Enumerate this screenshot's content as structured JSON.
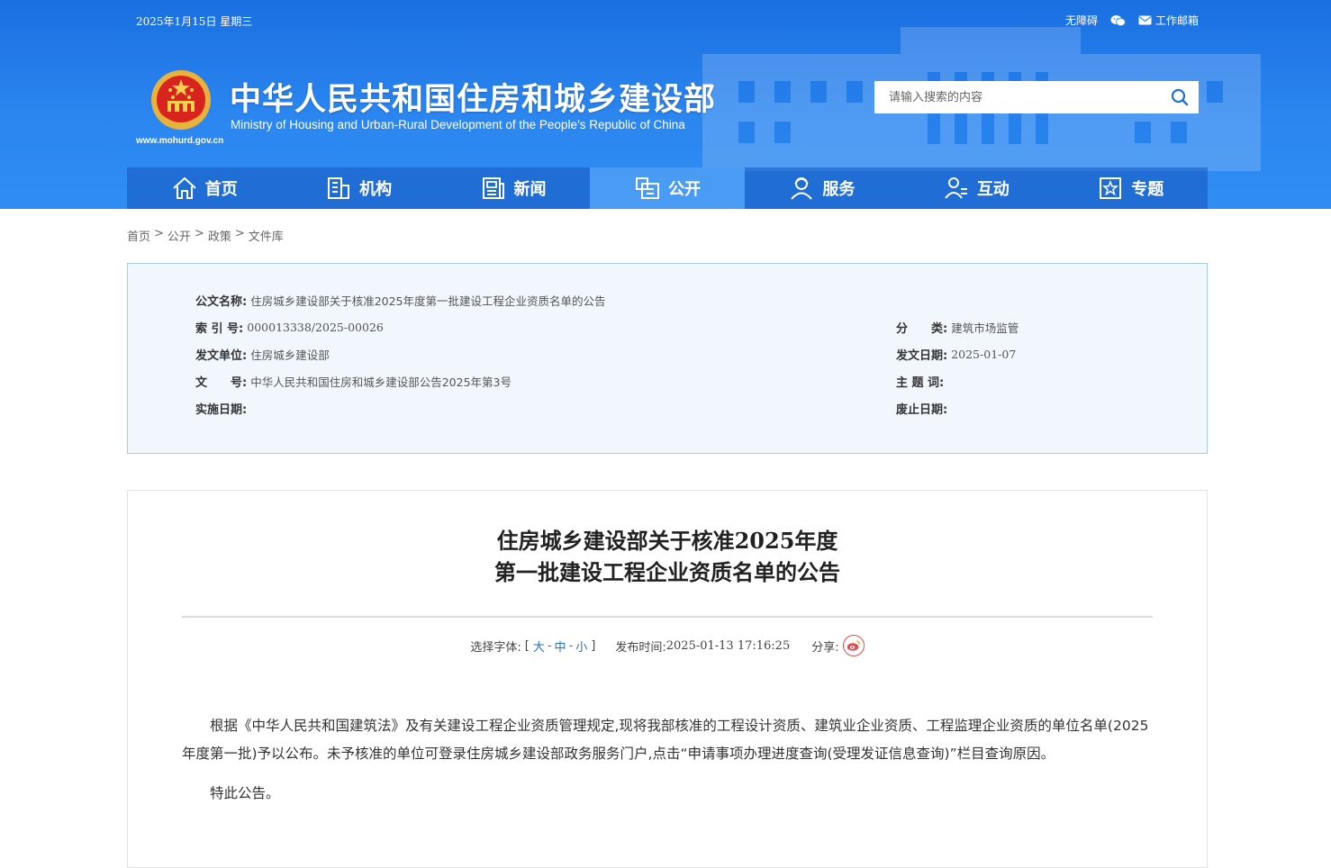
{
  "topbar": {
    "date": "2025年1月15日 星期三",
    "accessibility": "无障碍",
    "mail": "工作邮箱"
  },
  "brand": {
    "title_cn": "中华人民共和国住房和城乡建设部",
    "title_en": "Ministry of Housing and Urban-Rural Development of the People’s Republic of China",
    "url": "www.mohurd.gov.cn",
    "accent": "#2b86f0"
  },
  "search": {
    "placeholder": "请输入搜索的内容"
  },
  "nav": {
    "items": [
      {
        "label": "首页",
        "icon": "home-icon"
      },
      {
        "label": "机构",
        "icon": "building-icon"
      },
      {
        "label": "新闻",
        "icon": "newspaper-icon"
      },
      {
        "label": "公开",
        "icon": "document-icon",
        "active": true
      },
      {
        "label": "服务",
        "icon": "service-icon"
      },
      {
        "label": "互动",
        "icon": "interaction-icon"
      },
      {
        "label": "专题",
        "icon": "star-icon"
      }
    ]
  },
  "breadcrumb": {
    "items": [
      "首页",
      "公开",
      "政策",
      "文件库"
    ],
    "separator": ">"
  },
  "info": {
    "doc_name_label": "公文名称:",
    "doc_name": "住房城乡建设部关于核准2025年度第一批建设工程企业资质名单的公告",
    "index_label": "索 引 号:",
    "index": "000013338/2025-00026",
    "category_label": "分　　类:",
    "category": "建筑市场监管",
    "issuer_label": "发文单位:",
    "issuer": "住房城乡建设部",
    "issue_date_label": "发文日期:",
    "issue_date": "2025-01-07",
    "doc_no_label": "文　　号:",
    "doc_no": "中华人民共和国住房和城乡建设部公告2025年第3号",
    "keywords_label": "主 题 词:",
    "keywords": "",
    "effective_label": "实施日期:",
    "effective": "",
    "abolish_label": "废止日期:",
    "abolish": ""
  },
  "article": {
    "title_line1": "住房城乡建设部关于核准2025年度",
    "title_line2": "第一批建设工程企业资质名单的公告",
    "font_select_label": "选择字体:",
    "font_sizes": [
      "大",
      "中",
      "小"
    ],
    "bracket_open": "[",
    "bracket_close": "]",
    "publish_label": "发布时间:",
    "publish_time": "2025-01-13 17:16:25",
    "share_label": "分享:",
    "paragraphs": [
      "根据《中华人民共和国建筑法》及有关建设工程企业资质管理规定,现将我部核准的工程设计资质、建筑业企业资质、工程监理企业资质的单位名单(2025年度第一批)予以公布。未予核准的单位可登录住房城乡建设部政务服务门户,点击“申请事项办理进度查询(受理发证信息查询)”栏目查询原因。",
      "特此公告。"
    ]
  }
}
